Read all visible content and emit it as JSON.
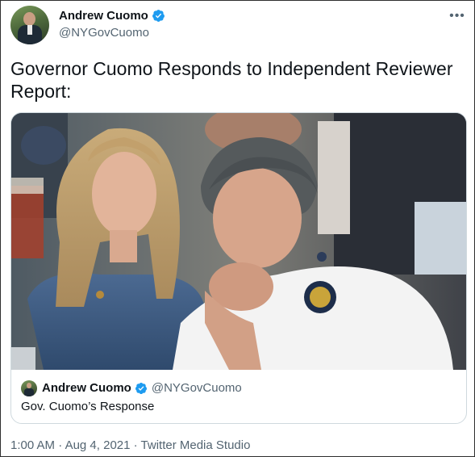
{
  "author": {
    "display_name": "Andrew Cuomo",
    "handle": "@NYGovCuomo",
    "verified": true
  },
  "more_label": "•••",
  "tweet": {
    "text": "Governor Cuomo Responds to Independent Reviewer Report:"
  },
  "quoted": {
    "display_name": "Andrew Cuomo",
    "handle": "@NYGovCuomo",
    "text": "Gov. Cuomo’s Response"
  },
  "meta": {
    "time": "1:00 AM",
    "sep1": " · ",
    "date": "Aug 4, 2021",
    "sep2": " · ",
    "source": "Twitter Media Studio"
  },
  "colors": {
    "text": "#0f1419",
    "secondary": "#536471",
    "verified": "#1d9bf0",
    "border": "#cfd9de"
  },
  "icons": {
    "verified": "verified-badge-icon",
    "more": "more-horizontal-icon"
  }
}
